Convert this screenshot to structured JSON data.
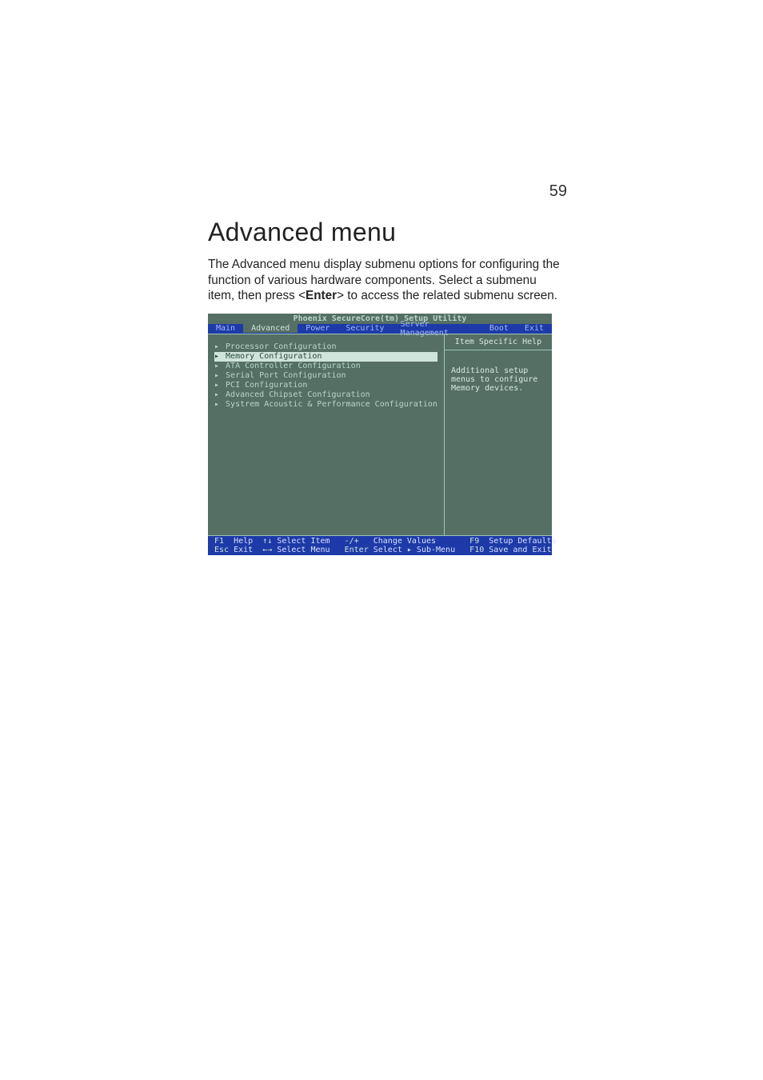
{
  "page_number": "59",
  "heading": "Advanced menu",
  "paragraph_before_bold": "The Advanced menu display submenu options for configuring the function of various hardware components. Select a submenu item, then press <",
  "bold_word": "Enter",
  "paragraph_after_bold": "> to access the related submenu screen.",
  "bios": {
    "title": "Phoenix SecureCore(tm) Setup Utility",
    "tabs": [
      "Main",
      "Advanced",
      "Power",
      "Security",
      "Server Management",
      "Boot",
      "Exit"
    ],
    "active_tab_index": 1,
    "menu_items": [
      "Processor Configuration",
      "Memory Configuration",
      "ATA Controller Configuration",
      "Serial Port Configuration",
      "PCI Configuration",
      "Advanced Chipset Configuration",
      "Systrem Acoustic & Performance Configuration"
    ],
    "selected_menu_index": 1,
    "help_header": "Item Specific Help",
    "help_lines": [
      "Additional setup",
      "menus to configure",
      "Memory devices."
    ],
    "footer": {
      "row1": {
        "k1": "F1",
        "t1": "Help",
        "k2": "↑↓",
        "t2": "Select Item",
        "k3": "-/+",
        "t3": "Change Values",
        "k4": "F9",
        "t4": "Setup Defaults"
      },
      "row2": {
        "k1": "Esc",
        "t1": "Exit",
        "k2": "←→",
        "t2": "Select Menu",
        "k3": "Enter",
        "t3": "Select ▸ Sub-Menu",
        "k4": "F10",
        "t4": "Save and Exit"
      }
    }
  }
}
